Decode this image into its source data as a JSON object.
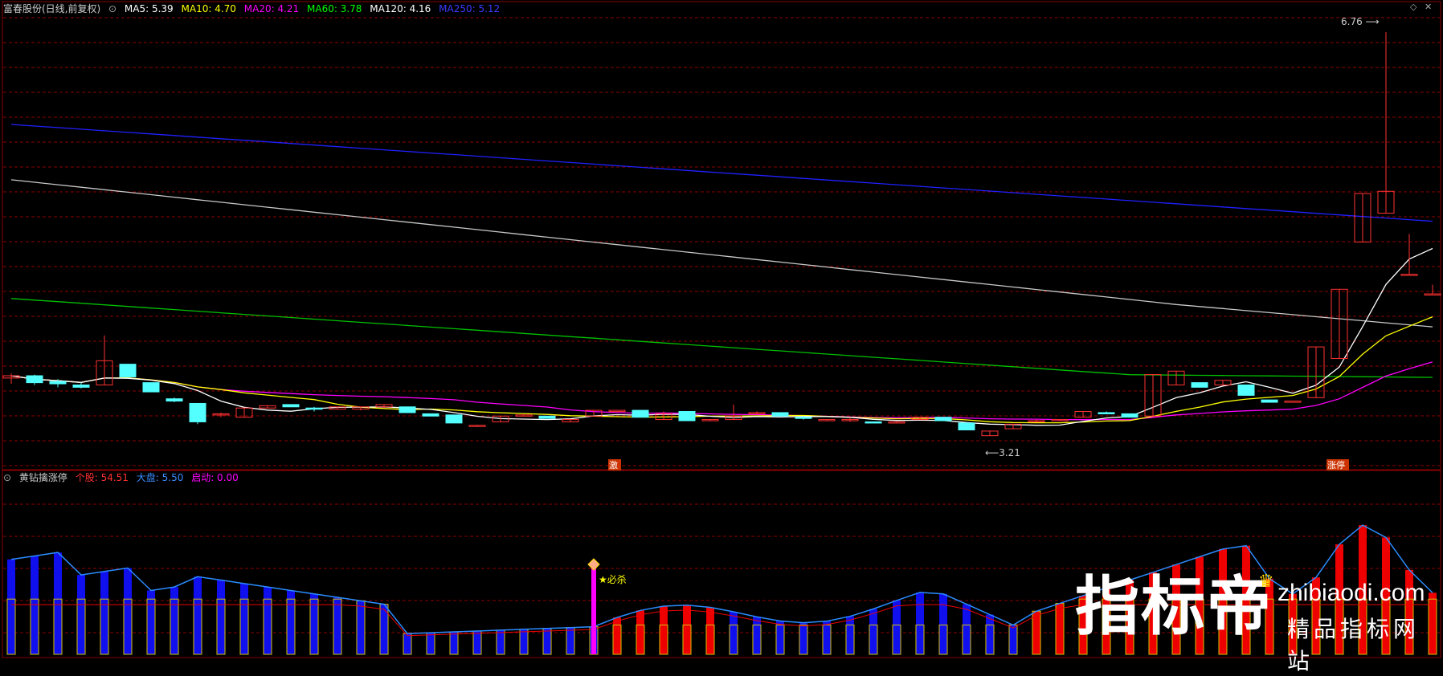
{
  "main_panel": {
    "stock_name": "富春股份(日线,前复权)",
    "ma": [
      {
        "label": "MA5: 5.39",
        "color": "#ffffff"
      },
      {
        "label": "MA10: 4.70",
        "color": "#ffff00"
      },
      {
        "label": "MA20: 4.21",
        "color": "#ff00ff"
      },
      {
        "label": "MA60: 3.78",
        "color": "#00ff00"
      },
      {
        "label": "MA120: 4.16",
        "color": "#ffffff"
      },
      {
        "label": "MA250: 5.12",
        "color": "#3a3aff"
      }
    ],
    "high_label": "6.76",
    "low_label": "3.21",
    "marker_left": "激",
    "marker_right": "涨停"
  },
  "sub_panel": {
    "indicator_name": "黄钻擒涨停",
    "values": [
      {
        "label": "个股: 54.51",
        "color": "#ff3030"
      },
      {
        "label": "大盘: 5.50",
        "color": "#3a8cff"
      },
      {
        "label": "启动: 0.00",
        "color": "#ff00ff"
      }
    ],
    "signal_label": "★必杀"
  },
  "watermark": {
    "cn": "指标帝",
    "domain": "zhibiaodi.com",
    "slogan": "精品指标网站"
  },
  "colors": {
    "up": "#ff3232",
    "down": "#54ffff",
    "grid": "#8b0000",
    "ma5": "#ffffff",
    "ma10": "#ffff00",
    "ma20": "#ff00ff",
    "ma60": "#00c000",
    "ma120": "#c8c8c8",
    "ma250": "#2020ff"
  },
  "chart_data": {
    "type": "candlestick",
    "price_range": [
      3.0,
      6.9
    ],
    "candles": [
      [
        3.76,
        3.8,
        3.71,
        3.78
      ],
      [
        3.78,
        3.79,
        3.7,
        3.72
      ],
      [
        3.73,
        3.75,
        3.68,
        3.71
      ],
      [
        3.7,
        3.72,
        3.67,
        3.68
      ],
      [
        3.7,
        4.13,
        3.7,
        3.91
      ],
      [
        3.88,
        3.88,
        3.77,
        3.77
      ],
      [
        3.72,
        3.72,
        3.64,
        3.64
      ],
      [
        3.58,
        3.59,
        3.55,
        3.56
      ],
      [
        3.54,
        3.54,
        3.36,
        3.38
      ],
      [
        3.45,
        3.46,
        3.42,
        3.45
      ],
      [
        3.42,
        3.5,
        3.42,
        3.5
      ],
      [
        3.5,
        3.5,
        3.52,
        3.52
      ],
      [
        3.53,
        3.53,
        3.51,
        3.51
      ],
      [
        3.5,
        3.51,
        3.47,
        3.49
      ],
      [
        3.49,
        3.51,
        3.49,
        3.51
      ],
      [
        3.49,
        3.51,
        3.48,
        3.51
      ],
      [
        3.51,
        3.53,
        3.5,
        3.53
      ],
      [
        3.51,
        3.51,
        3.46,
        3.46
      ],
      [
        3.45,
        3.45,
        3.43,
        3.43
      ],
      [
        3.44,
        3.44,
        3.37,
        3.37
      ],
      [
        3.34,
        3.34,
        3.35,
        3.35
      ],
      [
        3.38,
        3.38,
        3.43,
        3.43
      ],
      [
        3.43,
        3.44,
        3.43,
        3.44
      ],
      [
        3.43,
        3.43,
        3.41,
        3.41
      ],
      [
        3.38,
        3.38,
        3.4,
        3.4
      ],
      [
        3.43,
        3.44,
        3.48,
        3.48
      ],
      [
        3.48,
        3.48,
        3.48,
        3.48
      ],
      [
        3.48,
        3.48,
        3.42,
        3.42
      ],
      [
        3.4,
        3.47,
        3.4,
        3.45
      ],
      [
        3.47,
        3.47,
        3.39,
        3.39
      ],
      [
        3.39,
        3.39,
        3.4,
        3.4
      ],
      [
        3.4,
        3.53,
        3.4,
        3.43
      ],
      [
        3.46,
        3.47,
        3.45,
        3.46
      ],
      [
        3.46,
        3.46,
        3.43,
        3.43
      ],
      [
        3.42,
        3.43,
        3.4,
        3.41
      ],
      [
        3.39,
        3.39,
        3.4,
        3.4
      ],
      [
        3.4,
        3.42,
        3.38,
        3.4
      ],
      [
        3.38,
        3.38,
        3.37,
        3.37
      ],
      [
        3.37,
        3.37,
        3.38,
        3.38
      ],
      [
        3.4,
        3.4,
        3.42,
        3.42
      ],
      [
        3.42,
        3.42,
        3.39,
        3.39
      ],
      [
        3.37,
        3.37,
        3.31,
        3.31
      ],
      [
        3.26,
        3.26,
        3.3,
        3.3
      ],
      [
        3.32,
        3.32,
        3.36,
        3.36
      ],
      [
        3.39,
        3.4,
        3.38,
        3.39
      ],
      [
        3.39,
        3.39,
        3.4,
        3.4
      ],
      [
        3.42,
        3.42,
        3.47,
        3.47
      ],
      [
        3.46,
        3.47,
        3.45,
        3.45
      ],
      [
        3.45,
        3.45,
        3.42,
        3.42
      ],
      [
        3.43,
        3.43,
        3.79,
        3.79
      ],
      [
        3.7,
        3.7,
        3.82,
        3.82
      ],
      [
        3.72,
        3.72,
        3.68,
        3.68
      ],
      [
        3.7,
        3.74,
        3.7,
        3.74
      ],
      [
        3.7,
        3.7,
        3.61,
        3.61
      ],
      [
        3.57,
        3.57,
        3.55,
        3.55
      ],
      [
        3.56,
        3.56,
        3.56,
        3.56
      ],
      [
        3.59,
        3.59,
        4.03,
        4.03
      ],
      [
        3.93,
        3.93,
        4.53,
        4.53
      ],
      [
        4.94,
        4.94,
        5.36,
        5.36
      ],
      [
        5.19,
        6.76,
        5.19,
        5.38
      ],
      [
        4.66,
        5.01,
        4.66,
        4.66
      ],
      [
        4.49,
        4.57,
        4.49,
        4.49
      ]
    ]
  }
}
